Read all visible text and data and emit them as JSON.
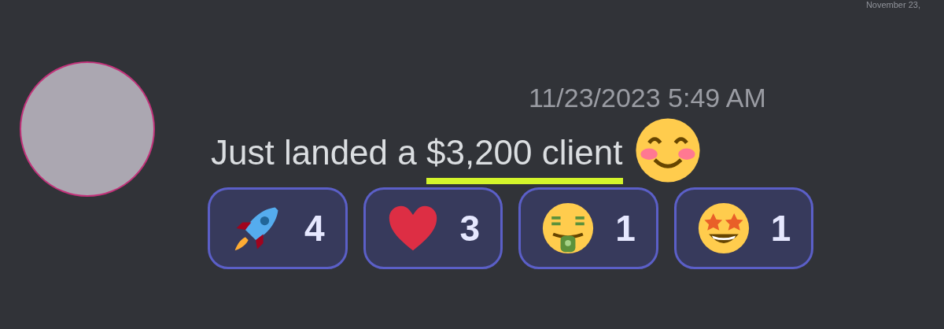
{
  "header_date": "November 23,",
  "message": {
    "timestamp": "11/23/2023 5:49 AM",
    "text": "Just landed a ",
    "highlighted_text": "$3,200 client"
  },
  "reactions": [
    {
      "kind": "rocket",
      "count": "4",
      "selected": true
    },
    {
      "kind": "heart",
      "count": "3",
      "selected": true
    },
    {
      "kind": "money",
      "count": "1",
      "selected": true
    },
    {
      "kind": "starstruck",
      "count": "1",
      "selected": true
    }
  ]
}
